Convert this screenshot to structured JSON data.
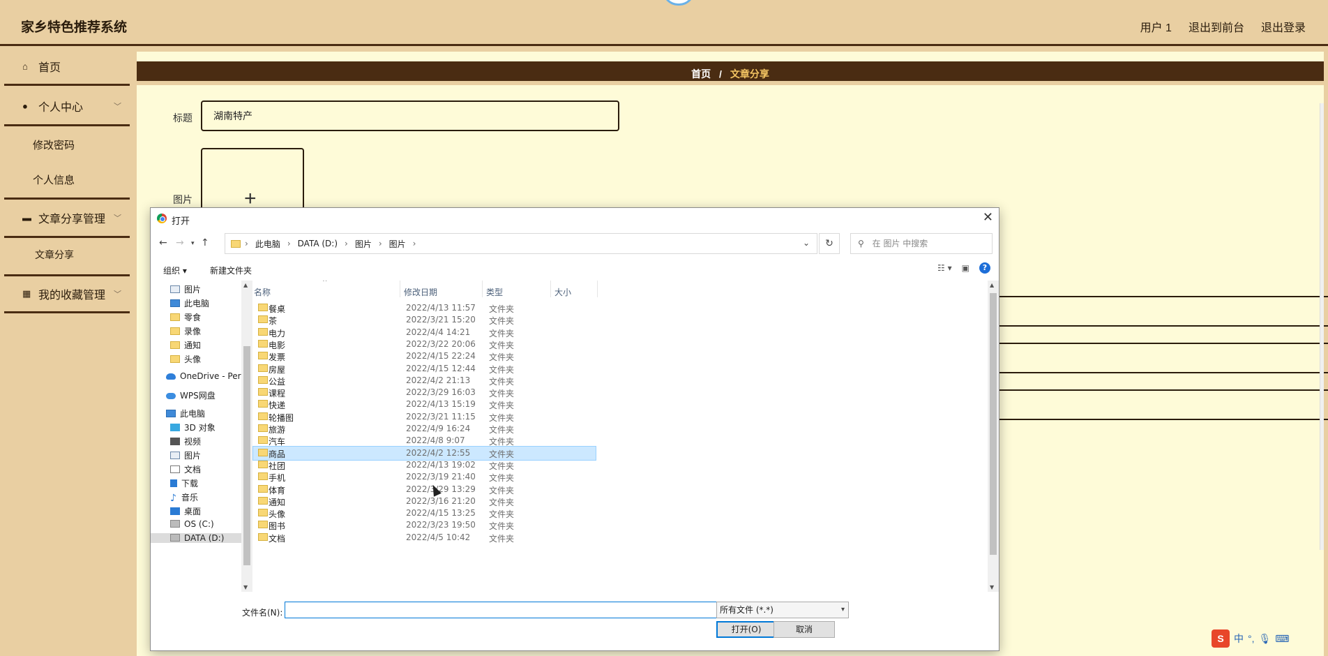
{
  "app": {
    "title": "家乡特色推荐系统",
    "top_links": [
      "用户 1",
      "退出到前台",
      "退出登录"
    ]
  },
  "sidebar": {
    "items": [
      {
        "icon": "home-icon",
        "label": "首页"
      },
      {
        "icon": "user-icon",
        "label": "个人中心"
      },
      {
        "icon": "monitor-icon",
        "label": "文章分享管理"
      },
      {
        "icon": "grid-icon",
        "label": "我的收藏管理"
      }
    ],
    "sub_personal": [
      "修改密码",
      "个人信息"
    ],
    "sub_article": [
      "文章分享"
    ]
  },
  "breadcrumb": {
    "home": "首页",
    "sep": "/",
    "current": "文章分享"
  },
  "form": {
    "title_label": "标题",
    "title_value": "湖南特产",
    "image_label": "图片",
    "upload_plus": "+"
  },
  "dialog": {
    "title": "打开",
    "close": "✕",
    "address": [
      "此电脑",
      "DATA (D:)",
      "图片",
      "图片"
    ],
    "search_placeholder": "在 图片 中搜索",
    "cmd_organize": "组织 ▾",
    "cmd_new_folder": "新建文件夹",
    "tree": [
      {
        "icon": "pic",
        "label": "图片",
        "pinned": true
      },
      {
        "icon": "pc",
        "label": "此电脑",
        "pinned": true
      },
      {
        "icon": "folder",
        "label": "零食"
      },
      {
        "icon": "folder",
        "label": "录像"
      },
      {
        "icon": "folder",
        "label": "通知"
      },
      {
        "icon": "folder",
        "label": "头像"
      },
      {
        "icon": "cloud",
        "label": "OneDrive - Perso"
      },
      {
        "icon": "wps",
        "label": "WPS网盘"
      },
      {
        "icon": "pc",
        "label": "此电脑"
      },
      {
        "icon": "cube",
        "label": "3D 对象"
      },
      {
        "icon": "video",
        "label": "视频"
      },
      {
        "icon": "pic",
        "label": "图片"
      },
      {
        "icon": "doc",
        "label": "文档"
      },
      {
        "icon": "down",
        "label": "下载"
      },
      {
        "icon": "music",
        "label": "音乐"
      },
      {
        "icon": "desk",
        "label": "桌面"
      },
      {
        "icon": "drive",
        "label": "OS (C:)"
      },
      {
        "icon": "drive",
        "label": "DATA (D:)"
      }
    ],
    "columns": [
      "名称",
      "修改日期",
      "类型",
      "大小"
    ],
    "files": [
      {
        "name": "餐桌",
        "date": "2022/4/13 11:57",
        "type": "文件夹"
      },
      {
        "name": "茶",
        "date": "2022/3/21 15:20",
        "type": "文件夹"
      },
      {
        "name": "电力",
        "date": "2022/4/4 14:21",
        "type": "文件夹"
      },
      {
        "name": "电影",
        "date": "2022/3/22 20:06",
        "type": "文件夹"
      },
      {
        "name": "发票",
        "date": "2022/4/15 22:24",
        "type": "文件夹"
      },
      {
        "name": "房屋",
        "date": "2022/4/15 12:44",
        "type": "文件夹"
      },
      {
        "name": "公益",
        "date": "2022/4/2 21:13",
        "type": "文件夹"
      },
      {
        "name": "课程",
        "date": "2022/3/29 16:03",
        "type": "文件夹"
      },
      {
        "name": "快递",
        "date": "2022/4/13 15:19",
        "type": "文件夹"
      },
      {
        "name": "轮播图",
        "date": "2022/3/21 11:15",
        "type": "文件夹"
      },
      {
        "name": "旅游",
        "date": "2022/4/9 16:24",
        "type": "文件夹"
      },
      {
        "name": "汽车",
        "date": "2022/4/8 9:07",
        "type": "文件夹"
      },
      {
        "name": "商品",
        "date": "2022/4/2 12:55",
        "type": "文件夹",
        "selected": true
      },
      {
        "name": "社团",
        "date": "2022/4/13 19:02",
        "type": "文件夹"
      },
      {
        "name": "手机",
        "date": "2022/3/19 21:40",
        "type": "文件夹"
      },
      {
        "name": "体育",
        "date": "2022/3/29 13:29",
        "type": "文件夹"
      },
      {
        "name": "通知",
        "date": "2022/3/16 21:20",
        "type": "文件夹"
      },
      {
        "name": "头像",
        "date": "2022/4/15 13:25",
        "type": "文件夹"
      },
      {
        "name": "图书",
        "date": "2022/3/23 19:50",
        "type": "文件夹"
      },
      {
        "name": "文档",
        "date": "2022/4/5 10:42",
        "type": "文件夹"
      }
    ],
    "filename_label": "文件名(N):",
    "filename_value": "",
    "filetype": "所有文件 (*.*)",
    "open_button": "打开(O)",
    "cancel_button": "取消"
  },
  "ime": {
    "logo": "S",
    "lang": "中"
  }
}
